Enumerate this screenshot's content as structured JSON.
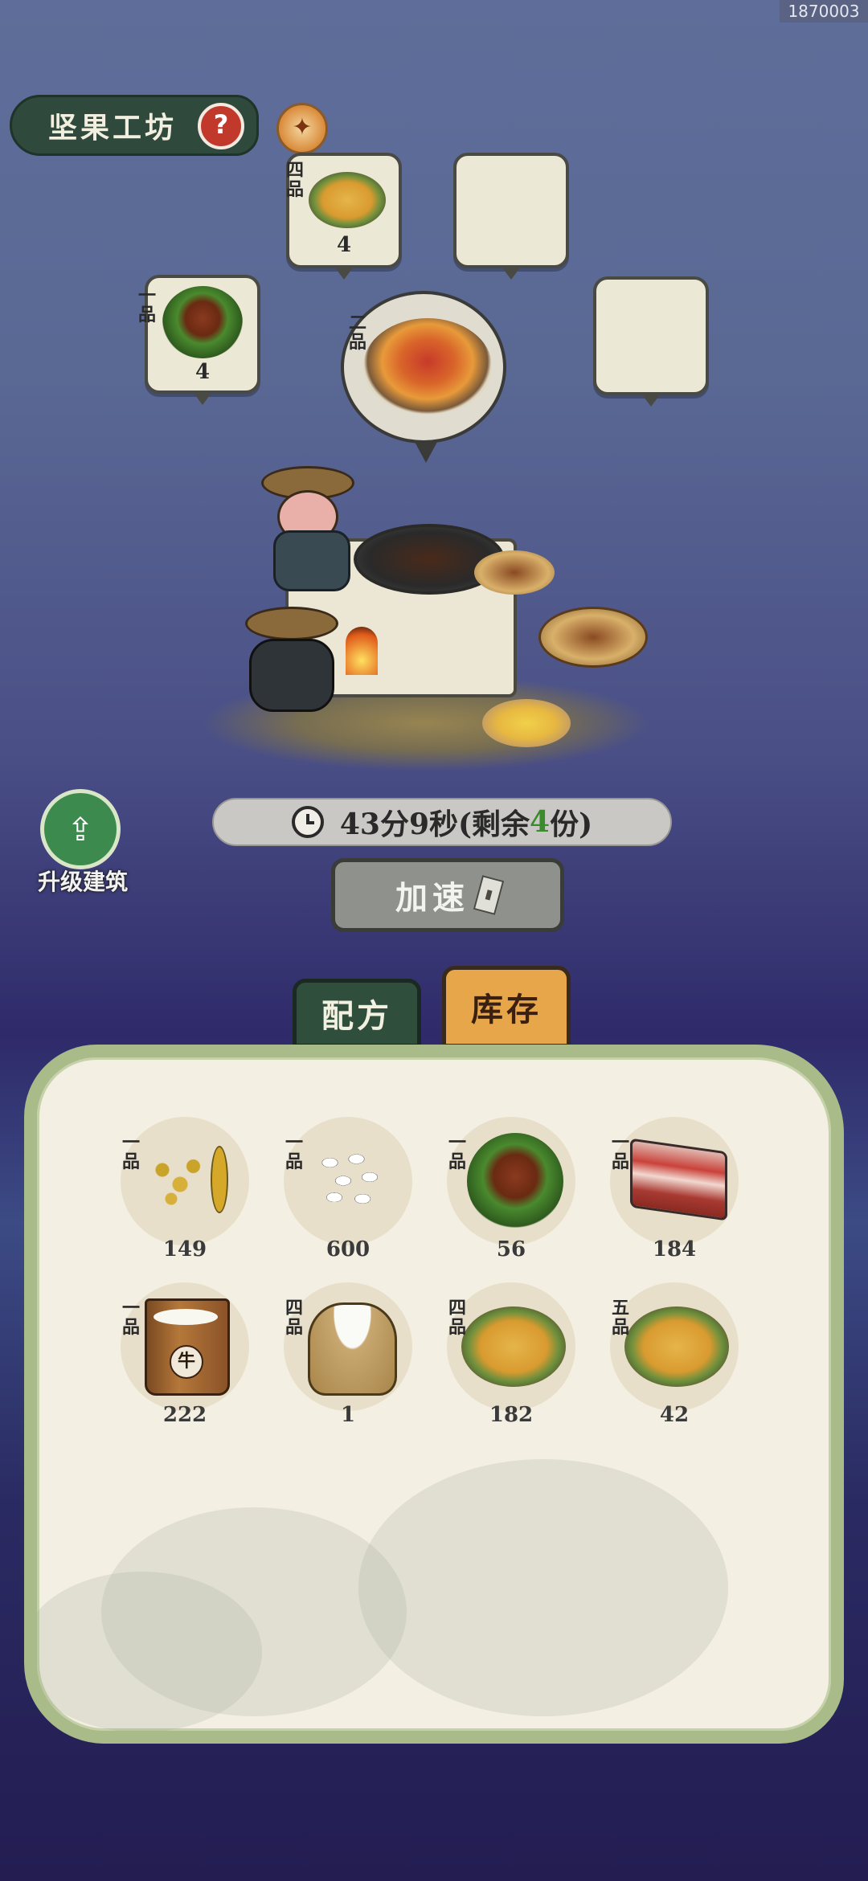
{
  "corner_id": "1870003",
  "header": {
    "title": "坚果工坊",
    "help_icon": "?"
  },
  "production": {
    "queue": [
      {
        "grade": "四品",
        "count": "4",
        "icon": "tofu-basket"
      },
      {
        "grade": "",
        "count": "",
        "icon": ""
      },
      {
        "grade": "一品",
        "count": "4",
        "icon": "chestnut"
      },
      {
        "grade": "",
        "count": "",
        "icon": ""
      }
    ],
    "current": {
      "grade": "二品",
      "icon": "roasted-chestnut-bowl"
    }
  },
  "timer": {
    "time": "43分9秒",
    "remaining_prefix": "(剩余",
    "remaining_count": "4",
    "remaining_suffix": "份)"
  },
  "upgrade": {
    "label": "升级建筑"
  },
  "speedup": {
    "label": "加速"
  },
  "tabs": {
    "recipe": "配方",
    "stock": "库存",
    "active": "stock"
  },
  "inventory": [
    {
      "grade": "一品",
      "count": "149",
      "icon": "soybean"
    },
    {
      "grade": "一品",
      "count": "600",
      "icon": "rice"
    },
    {
      "grade": "一品",
      "count": "56",
      "icon": "chestnut"
    },
    {
      "grade": "一品",
      "count": "184",
      "icon": "pork-belly"
    },
    {
      "grade": "一品",
      "count": "222",
      "icon": "milk-bucket"
    },
    {
      "grade": "四品",
      "count": "1",
      "icon": "flour-sack"
    },
    {
      "grade": "四品",
      "count": "182",
      "icon": "tofu-basket"
    },
    {
      "grade": "五品",
      "count": "42",
      "icon": "tofu-basket"
    }
  ],
  "colors": {
    "accent_green": "#3a8a2e",
    "tab_active": "#e8a64a",
    "tab_inactive": "#2f4e3c",
    "panel_border": "#a9bb88"
  }
}
